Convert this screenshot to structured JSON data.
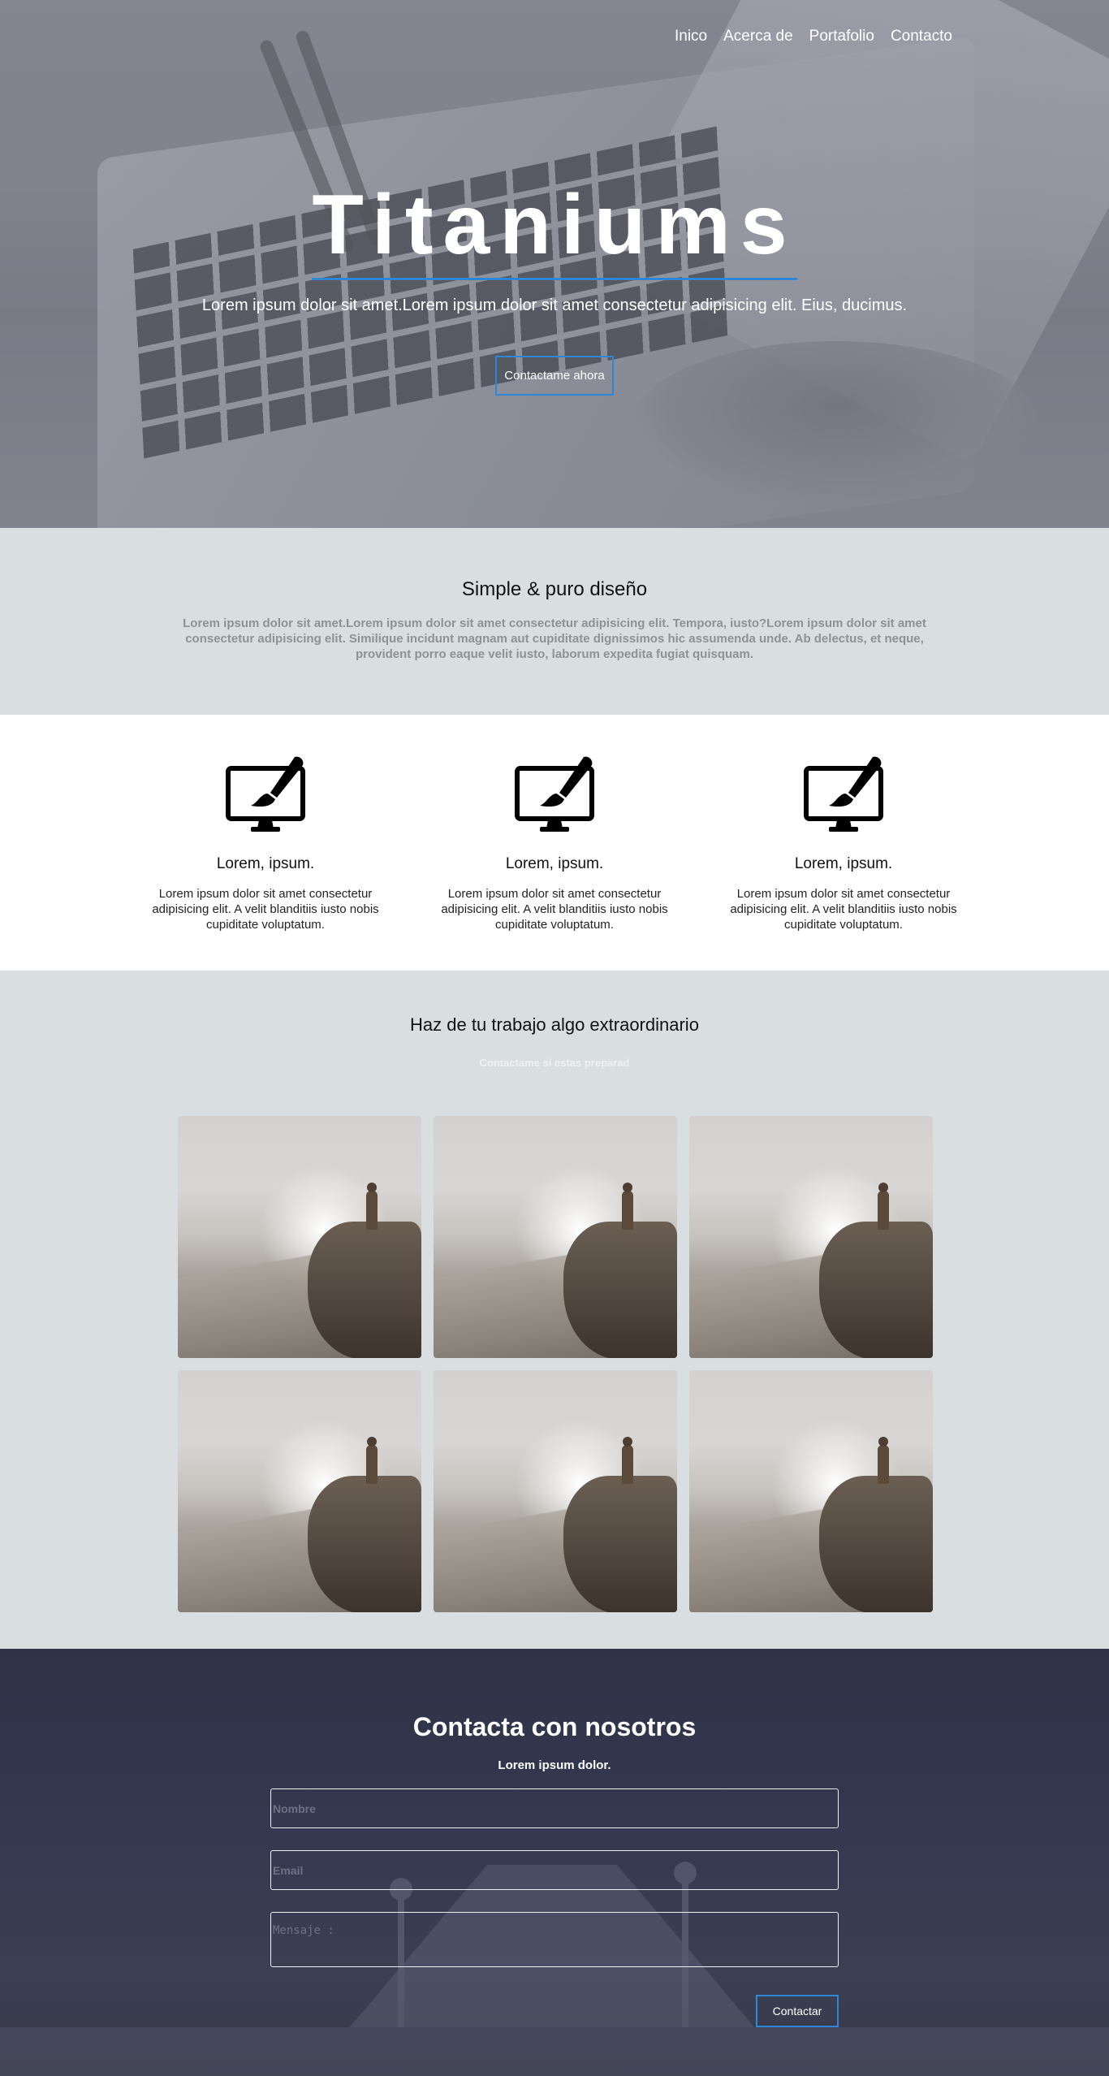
{
  "nav": {
    "items": [
      "Inico",
      "Acerca de",
      "Portafolio",
      "Contacto"
    ]
  },
  "hero": {
    "title": "Titaniums",
    "subtitle": "Lorem ipsum dolor sit amet.Lorem ipsum dolor sit amet consectetur adipisicing elit. Eius, ducimus.",
    "button": "Contactame ahora",
    "accent_color": "#2f86d6"
  },
  "simple": {
    "title": "Simple & puro diseño",
    "text": "Lorem ipsum dolor sit amet.Lorem ipsum dolor sit amet consectetur adipisicing elit. Tempora, iusto?Lorem ipsum dolor sit amet consectetur adipisicing elit. Similique incidunt magnam aut cupiditate dignissimos hic assumenda unde. Ab delectus, et neque, provident porro eaque velit iusto, laborum expedita fugiat quisquam."
  },
  "features": [
    {
      "icon": "monitor-brush-icon",
      "title": "Lorem, ipsum.",
      "text": "Lorem ipsum dolor sit amet consectetur adipisicing elit. A velit blanditiis iusto nobis cupiditate voluptatum."
    },
    {
      "icon": "monitor-brush-icon",
      "title": "Lorem, ipsum.",
      "text": "Lorem ipsum dolor sit amet consectetur adipisicing elit. A velit blanditiis iusto nobis cupiditate voluptatum."
    },
    {
      "icon": "monitor-brush-icon",
      "title": "Lorem, ipsum.",
      "text": "Lorem ipsum dolor sit amet consectetur adipisicing elit. A velit blanditiis iusto nobis cupiditate voluptatum."
    }
  ],
  "work": {
    "title": "Haz de tu trabajo algo extraordinario",
    "subtitle": "Contactame si estas preparad",
    "gallery_count": 6
  },
  "contact": {
    "title": "Contacta con nosotros",
    "subtitle": "Lorem ipsum dolor.",
    "name_placeholder": "Nombre",
    "email_placeholder": "Email",
    "message_placeholder": "Mensaje :",
    "submit": "Contactar"
  }
}
